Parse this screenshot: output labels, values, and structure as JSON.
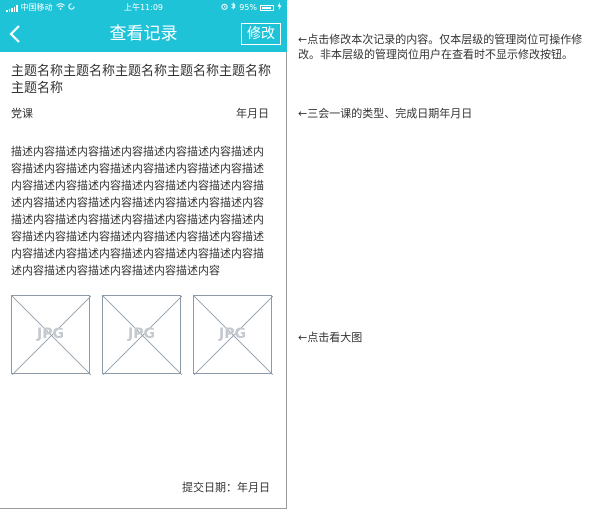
{
  "status_bar": {
    "carrier": "中国移动",
    "time": "上午11:09",
    "battery": "95%"
  },
  "nav": {
    "back_icon": "chevron-left-icon",
    "title": "查看记录",
    "edit_label": "修改"
  },
  "record": {
    "subject": "主题名称主题名称主题名称主题名称主题名称主题名称",
    "type": "党课",
    "date": "年月日",
    "description": "描述内容描述内容描述内容描述内容描述内容描述内容描述内容描述内容描述内容描述内容描述内容描述内容描述内容描述内容描述内容描述内容描述内容描述内容描述内容描述内容描述内容描述内容描述内容描述内容描述内容描述内容描述内容描述内容描述内容描述内容描述内容描述内容描述内容描述内容描述内容描述内容描述内容描述内容描述内容描述内容描述内容描述内容描述内容描述内容描述内容",
    "images": [
      {
        "label": "JPG"
      },
      {
        "label": "JPG"
      },
      {
        "label": "JPG"
      }
    ],
    "submit_label": "提交日期：年月日"
  },
  "annotations": {
    "edit_note": "←点击修改本次记录的内容。仅本层级的管理岗位可操作修改。非本层级的管理岗位用户在查看时不显示修改按钮。",
    "type_note": "←三会一课的类型、完成日期年月日",
    "image_note": "←点击看大图"
  },
  "colors": {
    "primary": "#1ec3d8",
    "image_border": "#8c9aa8",
    "placeholder_text": "#c4c9cf"
  }
}
